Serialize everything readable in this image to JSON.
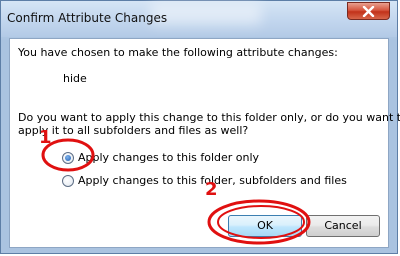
{
  "window": {
    "title": "Confirm Attribute Changes"
  },
  "dialog": {
    "intro_text": "You have chosen to make the following attribute changes:",
    "attribute_change": "hide",
    "question_line1": "Do you want to apply this change to this folder only, or do you want to",
    "question_line2": "apply it to all subfolders and files as well?",
    "options": [
      {
        "label": "Apply changes to this folder only",
        "selected": true
      },
      {
        "label": "Apply changes to this folder, subfolders and files",
        "selected": false
      }
    ],
    "ok_label": "OK",
    "cancel_label": "Cancel"
  },
  "annotations": {
    "marker_1": "1",
    "marker_2": "2",
    "color": "#e01010"
  },
  "icons": {
    "close": "close-icon"
  }
}
